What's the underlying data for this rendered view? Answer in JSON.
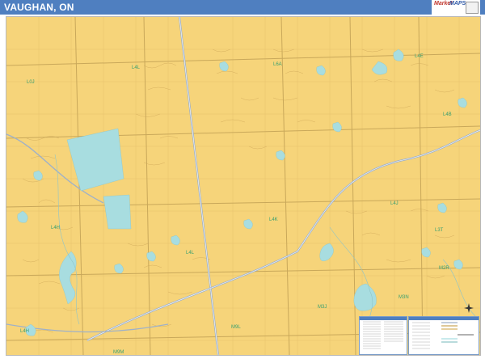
{
  "title": "VAUGHAN, ON",
  "logo": {
    "brand_left": "Market",
    "brand_right": "MAPS"
  },
  "colors": {
    "land": "#f6d47a",
    "water": "#a8dde0",
    "header": "#4f7fc0",
    "label": "#3aa070",
    "roads": "#c9a85a"
  },
  "map_labels": [
    {
      "text": "L4L"
    },
    {
      "text": "L6A"
    },
    {
      "text": "L4E"
    },
    {
      "text": "L0J"
    },
    {
      "text": "L4B"
    },
    {
      "text": "L4H"
    },
    {
      "text": "L4K"
    },
    {
      "text": "L4J"
    },
    {
      "text": "L3T"
    },
    {
      "text": "M2R"
    },
    {
      "text": "M3N"
    },
    {
      "text": "M3J"
    },
    {
      "text": "L4H"
    },
    {
      "text": "M9L"
    },
    {
      "text": "M9M"
    },
    {
      "text": "L4L"
    }
  ]
}
